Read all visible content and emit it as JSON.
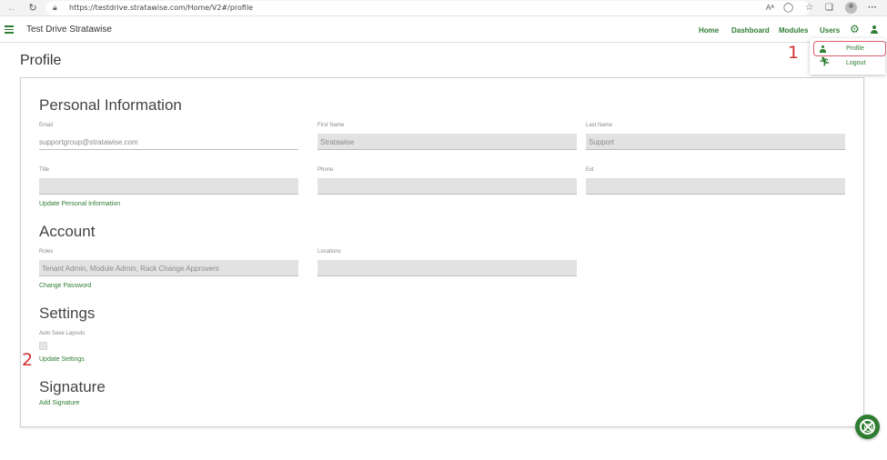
{
  "browser": {
    "url": "https://testdrive.stratawise.com/Home/V2#/profile",
    "icons": [
      "back-icon",
      "refresh-icon",
      "lock-icon",
      "read-aloud-icon",
      "app-available-icon",
      "favorites-icon",
      "collections-icon",
      "profile-avatar-icon",
      "more-icon"
    ],
    "read_aloud": "Aᴬ",
    "more": "···"
  },
  "header": {
    "app_title": "Test Drive Stratawise",
    "nav": [
      "Home",
      "Dashboard",
      "Modules",
      "Users"
    ],
    "accent_color": "#2e7d32"
  },
  "user_menu": {
    "items": [
      {
        "label": "Profile",
        "icon": "person-icon"
      },
      {
        "label": "Logout",
        "icon": "running-man-icon"
      }
    ],
    "highlight_color": "#e05a6a"
  },
  "annotations": [
    "1",
    "2"
  ],
  "page": {
    "title": "Profile"
  },
  "personal": {
    "title": "Personal Information",
    "email_label": "Email",
    "email_value": "supportgroup@stratawise.com",
    "first_name_label": "First Name",
    "first_name_value": "Stratawise",
    "last_name_label": "Last Name",
    "last_name_value": "Support",
    "title_label": "Title",
    "title_value": "",
    "phone_label": "Phone",
    "phone_value": "",
    "ext_label": "Ext",
    "ext_value": "",
    "action": "Update Personal Information"
  },
  "account": {
    "title": "Account",
    "roles_label": "Roles",
    "roles_value": "Tenant Admin, Module Admin, Rack Change Approvers",
    "locations_label": "Locations",
    "locations_value": "",
    "action": "Change Password"
  },
  "settings": {
    "title": "Settings",
    "auto_save_label": "Auto Save Layouts",
    "auto_save_checked": false,
    "action": "Update Settings"
  },
  "signature": {
    "title": "Signature",
    "action": "Add Signature"
  },
  "fab": {
    "icon": "support-lifebuoy-icon"
  }
}
